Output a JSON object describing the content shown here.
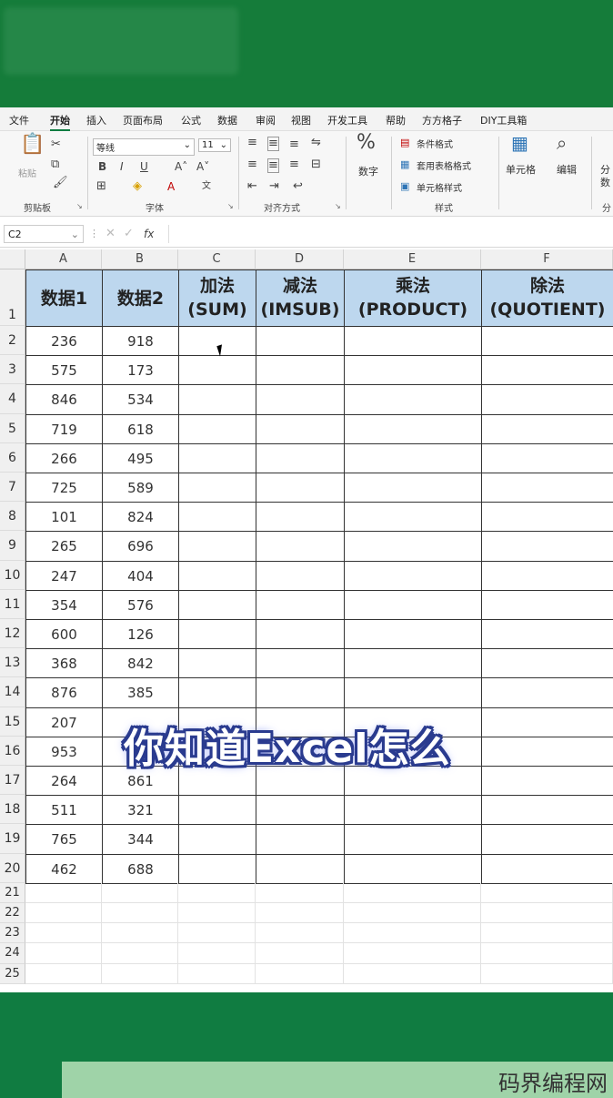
{
  "menu": {
    "tabs": [
      "文件",
      "开始",
      "插入",
      "页面布局",
      "公式",
      "数据",
      "审阅",
      "视图",
      "开发工具",
      "帮助",
      "方方格子",
      "DIY工具箱"
    ]
  },
  "ribbon": {
    "paste_label": "粘贴",
    "clipboard_group": "剪贴板",
    "font_name": "等线",
    "font_size": "11",
    "font_group": "字体",
    "align_group": "对齐方式",
    "number_label": "数字",
    "cond_format": "条件格式",
    "table_format": "套用表格格式",
    "cell_style": "单元格样式",
    "style_group": "样式",
    "cells_label": "单元格",
    "edit_label": "编辑",
    "split_label": "分",
    "split_label2": "数",
    "split_group": "分"
  },
  "formula_bar": {
    "name_box": "C2",
    "fx": "fx",
    "content": ""
  },
  "columns": [
    "A",
    "B",
    "C",
    "D",
    "E",
    "F"
  ],
  "header_row": {
    "a": "数据1",
    "b": "数据2",
    "c1": "加法",
    "c2": "(SUM)",
    "d1": "减法",
    "d2": "(IMSUB)",
    "e1": "乘法",
    "e2": "(PRODUCT)",
    "f1": "除法",
    "f2": "(QUOTIENT)"
  },
  "rows": [
    [
      236,
      918
    ],
    [
      575,
      173
    ],
    [
      846,
      534
    ],
    [
      719,
      618
    ],
    [
      266,
      495
    ],
    [
      725,
      589
    ],
    [
      101,
      824
    ],
    [
      265,
      696
    ],
    [
      247,
      404
    ],
    [
      354,
      576
    ],
    [
      600,
      126
    ],
    [
      368,
      842
    ],
    [
      876,
      385
    ],
    [
      207,
      ""
    ],
    [
      953,
      ""
    ],
    [
      264,
      861
    ],
    [
      511,
      321
    ],
    [
      765,
      344
    ],
    [
      462,
      688
    ]
  ],
  "row_numbers": [
    "1",
    "2",
    "3",
    "4",
    "5",
    "6",
    "7",
    "8",
    "9",
    "10",
    "11",
    "12",
    "13",
    "14",
    "15",
    "16",
    "17",
    "18",
    "19",
    "20",
    "21",
    "22",
    "23",
    "24",
    "25"
  ],
  "caption": "你知道Excel怎么",
  "watermark": "码界编程网",
  "colors": {
    "accent": "#107c41",
    "header_fill": "#bdd7ee",
    "caption_outline": "#2a3b8f"
  }
}
